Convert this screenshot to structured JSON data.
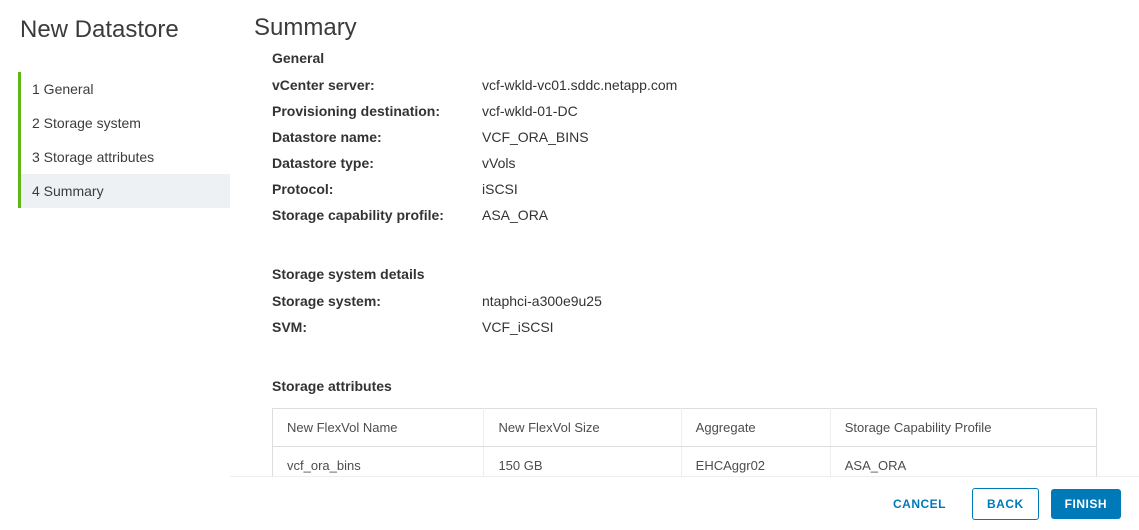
{
  "sidebar": {
    "title": "New Datastore",
    "steps": [
      {
        "label": "1 General"
      },
      {
        "label": "2 Storage system"
      },
      {
        "label": "3 Storage attributes"
      },
      {
        "label": "4 Summary"
      }
    ]
  },
  "main": {
    "title": "Summary",
    "sections": {
      "general": {
        "heading": "General",
        "rows": {
          "vcenter": {
            "label": "vCenter server:",
            "value": "vcf-wkld-vc01.sddc.netapp.com"
          },
          "dest": {
            "label": "Provisioning destination:",
            "value": "vcf-wkld-01-DC"
          },
          "dsname": {
            "label": "Datastore name:",
            "value": "VCF_ORA_BINS"
          },
          "dstype": {
            "label": "Datastore type:",
            "value": "vVols"
          },
          "proto": {
            "label": "Protocol:",
            "value": "iSCSI"
          },
          "scp": {
            "label": "Storage capability profile:",
            "value": "ASA_ORA"
          }
        }
      },
      "storage": {
        "heading": "Storage system details",
        "rows": {
          "system": {
            "label": "Storage system:",
            "value": "ntaphci-a300e9u25"
          },
          "svm": {
            "label": "SVM:",
            "value": "VCF_iSCSI"
          }
        }
      },
      "attrs": {
        "heading": "Storage attributes",
        "columns": {
          "c0": "New FlexVol Name",
          "c1": "New FlexVol Size",
          "c2": "Aggregate",
          "c3": "Storage Capability Profile"
        },
        "row0": {
          "name": "vcf_ora_bins",
          "size": "150 GB",
          "aggr": "EHCAggr02",
          "scp": "ASA_ORA"
        }
      }
    }
  },
  "footer": {
    "cancel": "CANCEL",
    "back": "BACK",
    "finish": "FINISH"
  }
}
